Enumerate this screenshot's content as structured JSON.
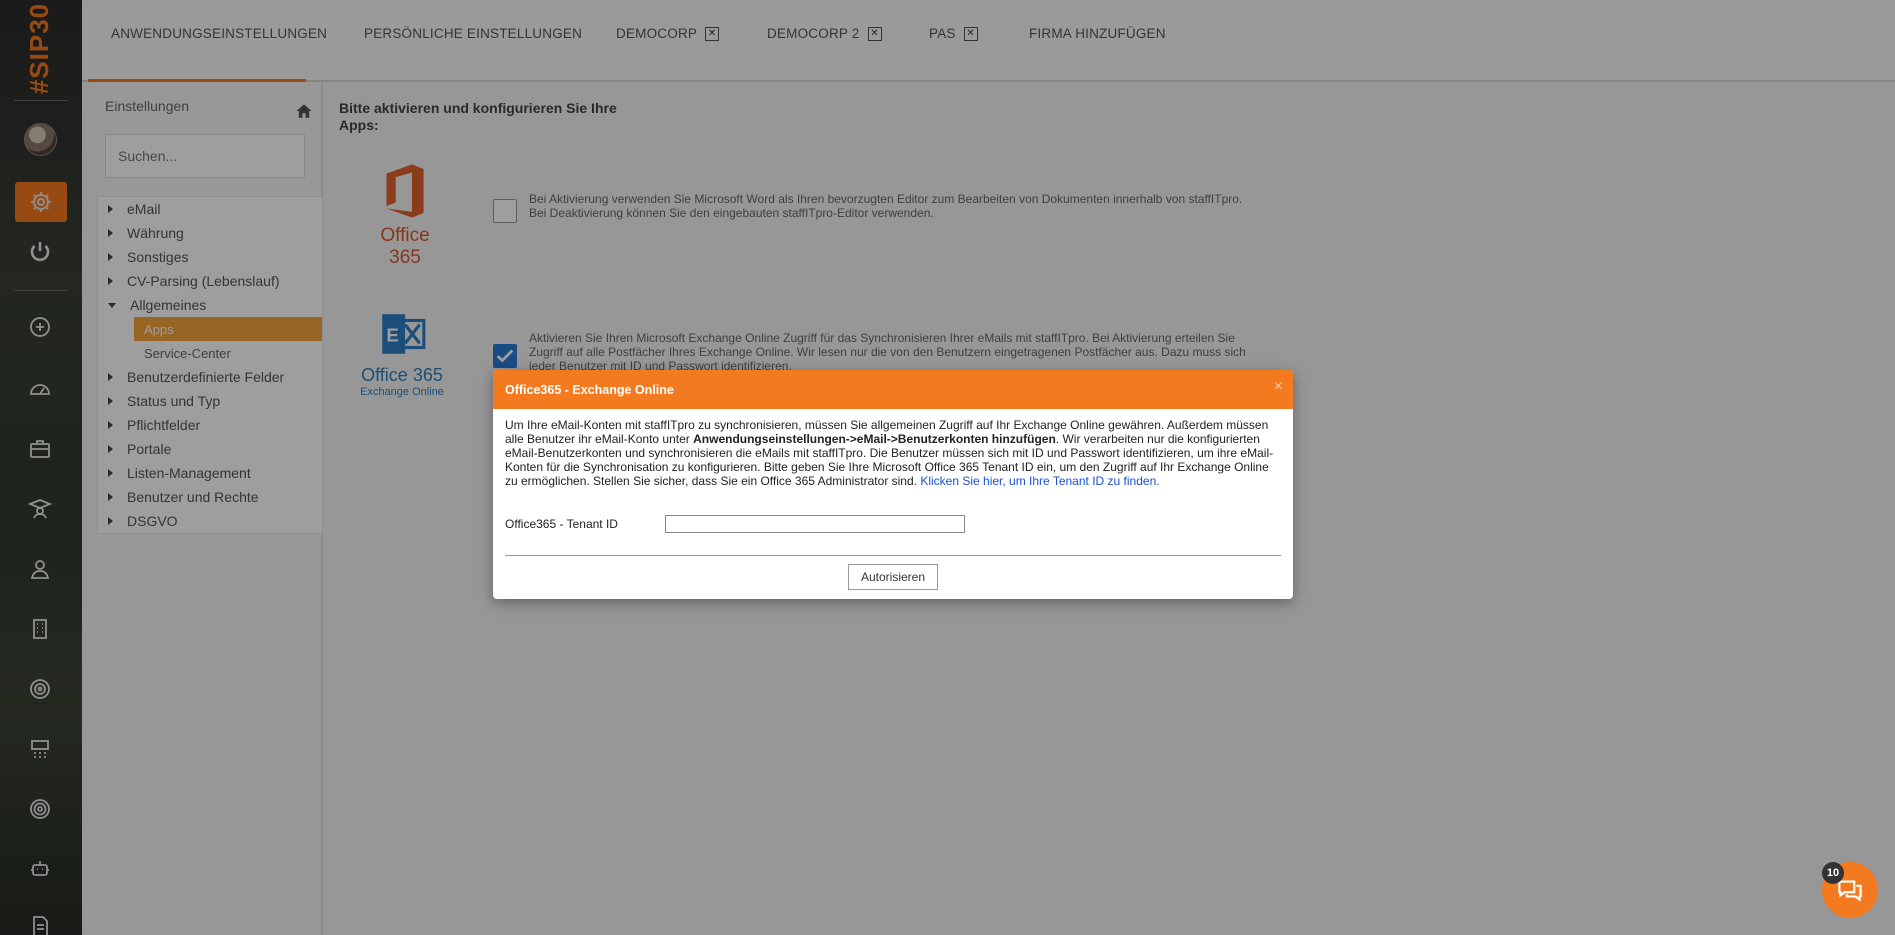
{
  "app": {
    "brand": "#SIP30"
  },
  "tabs": [
    {
      "label": "ANWENDUNGSEINSTELLUNGEN",
      "active": true
    },
    {
      "label": "PERSÖNLICHE EINSTELLUNGEN"
    },
    {
      "label": "DEMOCORP",
      "closable": true
    },
    {
      "label": "DEMOCORP 2",
      "closable": true
    },
    {
      "label": "PAS",
      "closable": true
    },
    {
      "label": "FIRMA HINZUFÜGEN"
    }
  ],
  "rail": {
    "icons": [
      "settings-icon",
      "power-icon",
      "add-icon",
      "dashboard-icon",
      "briefcase-icon",
      "graduate-icon",
      "person-icon",
      "building-icon",
      "target-icon",
      "org-chart-icon",
      "radar-icon",
      "robot-icon",
      "document-icon"
    ]
  },
  "sidebar": {
    "title": "Einstellungen",
    "search_placeholder": "Suchen...",
    "items": [
      {
        "label": "eMail"
      },
      {
        "label": "Währung"
      },
      {
        "label": "Sonstiges"
      },
      {
        "label": "CV-Parsing (Lebenslauf)"
      },
      {
        "label": "Allgemeines",
        "expanded": true
      },
      {
        "label": "Apps",
        "child": true,
        "selected": true
      },
      {
        "label": "Service-Center",
        "child": true
      },
      {
        "label": "Benutzerdefinierte Felder"
      },
      {
        "label": "Status und Typ"
      },
      {
        "label": "Pflichtfelder"
      },
      {
        "label": "Portale"
      },
      {
        "label": "Listen-Management"
      },
      {
        "label": "Benutzer und Rechte"
      },
      {
        "label": "DSGVO"
      }
    ]
  },
  "main": {
    "heading": "Bitte aktivieren und konfigurieren Sie Ihre Apps:",
    "apps": [
      {
        "logo_text": "Office 365",
        "description": "Bei Aktivierung verwenden Sie Microsoft Word als Ihren bevorzugten Editor zum Bearbeiten von Dokumenten innerhalb von staffITpro. Bei Deaktivierung können Sie den eingebauten staffITpro-Editor verwenden.",
        "checked": false
      },
      {
        "logo_text": "Office 365",
        "logo_subtext": "Exchange Online",
        "description": "Aktivieren Sie Ihren Microsoft Exchange Online Zugriff für das Synchronisieren Ihrer eMails mit staffITpro. Bei Aktivierung erteilen Sie Zugriff auf alle Postfächer Ihres Exchange Online. Wir lesen nur die von den Benutzern eingetragenen Postfächer aus. Dazu muss sich jeder Benutzer mit ID und Passwort identifizieren.",
        "checked": true
      }
    ]
  },
  "modal": {
    "title": "Office365 - Exchange Online",
    "close": "×",
    "body_part1": "Um Ihre eMail-Konten mit staffITpro zu synchronisieren, müssen Sie allgemeinen Zugriff auf Ihr Exchange Online gewähren. Außerdem müssen alle Benutzer ihr eMail-Konto unter ",
    "body_bold": "Anwendungseinstellungen->eMail->Benutzerkonten hinzufügen",
    "body_part2": ". Wir verarbeiten nur die konfigurierten eMail-Benutzerkonten und synchronisieren die eMails mit staffITpro. Die Benutzer müssen sich mit ID und Passwort identifizieren, um ihre eMail-Konten für die Synchronisation zu konfigurieren. Bitte geben Sie Ihre Microsoft Office 365 Tenant ID ein, um den Zugriff auf Ihr Exchange Online zu ermöglichen. Stellen Sie sicher, dass Sie ein Office 365 Administrator sind. ",
    "body_link": "Klicken Sie hier, um Ihre Tenant ID zu finden.",
    "tenant_label": "Office365 - Tenant ID",
    "tenant_value": "",
    "authorize_label": "Autorisieren"
  },
  "chat": {
    "badge": "10"
  },
  "colors": {
    "accent": "#f47a20",
    "selected": "#f6a43a",
    "link": "#1a4fd6",
    "checkbox": "#2b7bd6"
  }
}
